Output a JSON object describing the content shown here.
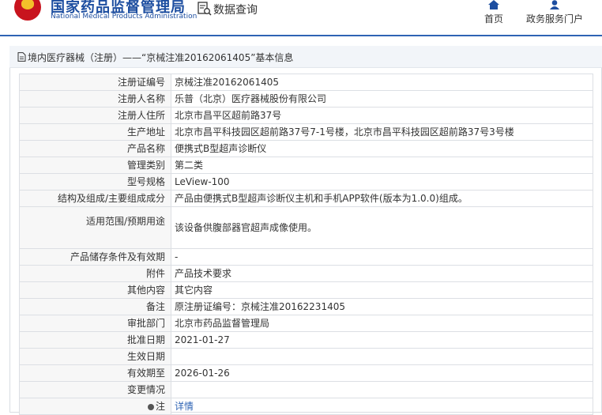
{
  "header": {
    "site_name_cn": "国家药品监督管理局",
    "site_name_en": "National Medical Products Administration",
    "query_label": "数据查询",
    "nav": [
      {
        "label": "首页",
        "icon": "home-icon"
      },
      {
        "label": "政务服务门户",
        "icon": "user-icon"
      }
    ]
  },
  "panel": {
    "title": "境内医疗器械（注册）——“京械注准20162061405”基本信息",
    "title_icon": "document-icon"
  },
  "rows": [
    {
      "label": "注册证编号",
      "value": "京械注准20162061405"
    },
    {
      "label": "注册人名称",
      "value": "乐普（北京）医疗器械股份有限公司"
    },
    {
      "label": "注册人住所",
      "value": "北京市昌平区超前路37号"
    },
    {
      "label": "生产地址",
      "value": "北京市昌平科技园区超前路37号7-1号楼，北京市昌平科技园区超前路37号3号楼"
    },
    {
      "label": "产品名称",
      "value": "便携式B型超声诊断仪"
    },
    {
      "label": "管理类别",
      "value": "第二类"
    },
    {
      "label": "型号规格",
      "value": "LeView-100"
    },
    {
      "label": "结构及组成/主要组成成分",
      "value": "产品由便携式B型超声诊断仪主机和手机APP软件(版本为1.0.0)组成。"
    },
    {
      "label": "适用范围/预期用途",
      "value": "该设备供腹部器官超声成像使用。"
    },
    {
      "label": "产品储存条件及有效期",
      "value": "-"
    },
    {
      "label": "附件",
      "value": "产品技术要求"
    },
    {
      "label": "其他内容",
      "value": "其它内容"
    },
    {
      "label": "备注",
      "value": "原注册证编号：京械注准20162231405"
    },
    {
      "label": "审批部门",
      "value": "北京市药品监督管理局"
    },
    {
      "label": "批准日期",
      "value": "2021-01-27"
    },
    {
      "label": "生效日期",
      "value": ""
    },
    {
      "label": "有效期至",
      "value": "2026-01-26"
    },
    {
      "label": "变更情况",
      "value": ""
    },
    {
      "label": "注",
      "value": "详情"
    }
  ],
  "colors": {
    "brand_blue": "#1d4ea0",
    "link_blue": "#2f64b4",
    "emblem_red": "#c8141e"
  }
}
